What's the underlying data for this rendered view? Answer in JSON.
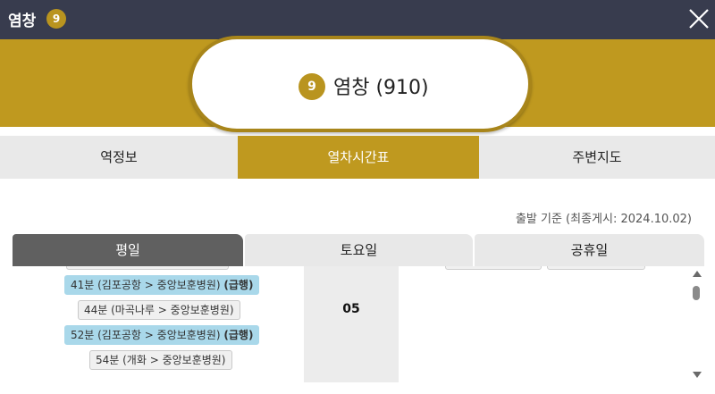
{
  "header": {
    "title": "염창",
    "line_number": "9",
    "close_icon": "close-icon"
  },
  "station": {
    "line_number": "9",
    "name": "염창 (910)"
  },
  "tabs": [
    {
      "label": "역정보",
      "active": false
    },
    {
      "label": "열차시간표",
      "active": true
    },
    {
      "label": "주변지도",
      "active": false
    }
  ],
  "basis_text": "출발 기준 (최종게시: 2024.10.02)",
  "day_tabs": [
    {
      "label": "평일",
      "active": true
    },
    {
      "label": "토요일",
      "active": false
    },
    {
      "label": "공휴일",
      "active": false
    }
  ],
  "timetable": {
    "hour": "05",
    "entries": [
      {
        "text": "41분 (김포공항 > 중앙보훈병원)",
        "express_label": "(급행)",
        "express": true
      },
      {
        "text": "44분 (마곡나루 > 중앙보훈병원)",
        "express_label": "",
        "express": false
      },
      {
        "text": "52분 (김포공항 > 중앙보훈병원)",
        "express_label": "(급행)",
        "express": true
      },
      {
        "text": "54분 (개화 > 중앙보훈병원)",
        "express_label": "",
        "express": false
      }
    ]
  },
  "colors": {
    "header_bg": "#383c4e",
    "accent": "#bf991f",
    "express_chip": "#a9d8ea",
    "active_day_tab": "#606060"
  }
}
